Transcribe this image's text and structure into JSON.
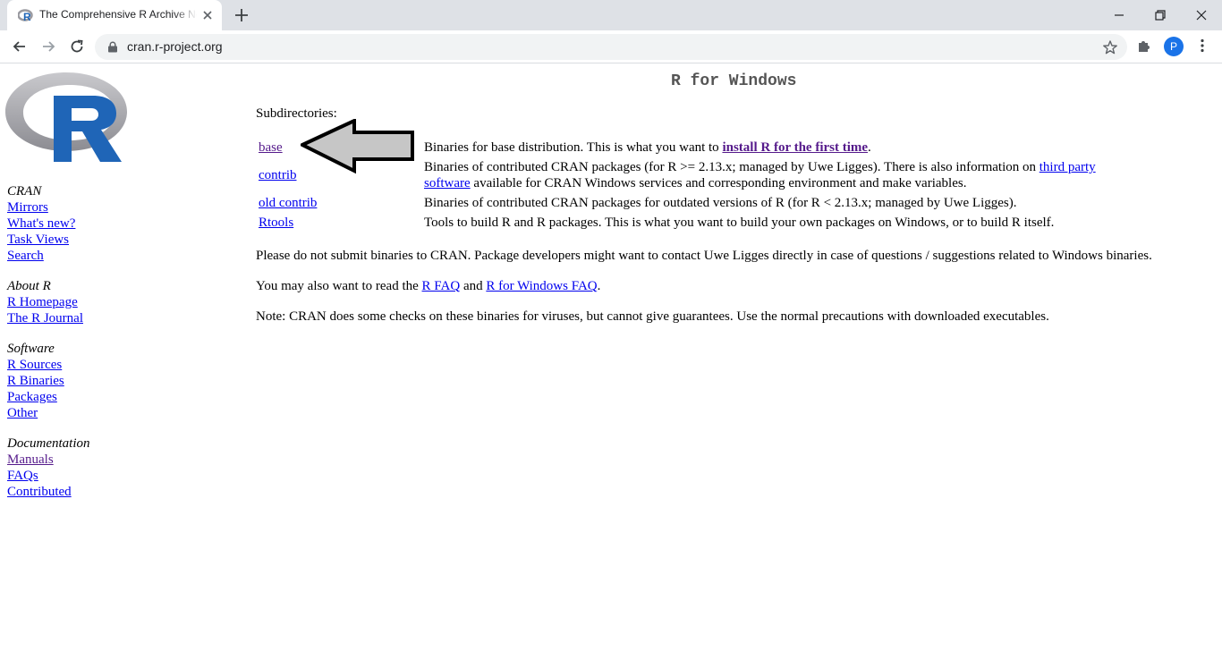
{
  "browser": {
    "tab_title": "The Comprehensive R Archive Network",
    "url": "cran.r-project.org",
    "avatar_letter": "P"
  },
  "sidebar": {
    "groups": [
      {
        "heading": "CRAN",
        "links": [
          "Mirrors",
          "What's new?",
          "Task Views",
          "Search"
        ]
      },
      {
        "heading": "About R",
        "links": [
          "R Homepage",
          "The R Journal"
        ]
      },
      {
        "heading": "Software",
        "links": [
          "R Sources",
          "R Binaries",
          "Packages",
          "Other"
        ]
      },
      {
        "heading": "Documentation",
        "links": [
          "Manuals",
          "FAQs",
          "Contributed"
        ]
      }
    ]
  },
  "main": {
    "title": "R for Windows",
    "subdir_label": "Subdirectories:",
    "rows": [
      {
        "name": "base",
        "desc_pre": "Binaries for base distribution. This is what you want to ",
        "desc_link": "install R for the first time",
        "desc_post": "."
      },
      {
        "name": "contrib",
        "desc_pre": "Binaries of contributed CRAN packages (for R >= 2.13.x; managed by Uwe Ligges). There is also information on ",
        "desc_link": "third party software",
        "desc_post": " available for CRAN Windows services and corresponding environment and make variables."
      },
      {
        "name": "old contrib",
        "desc": "Binaries of contributed CRAN packages for outdated versions of R (for R < 2.13.x; managed by Uwe Ligges)."
      },
      {
        "name": "Rtools",
        "desc": "Tools to build R and R packages. This is what you want to build your own packages on Windows, or to build R itself."
      }
    ],
    "para1": "Please do not submit binaries to CRAN. Package developers might want to contact Uwe Ligges directly in case of questions / suggestions related to Windows binaries.",
    "para2_pre": "You may also want to read the ",
    "para2_link1": "R FAQ",
    "para2_mid": " and ",
    "para2_link2": "R for Windows FAQ",
    "para2_post": ".",
    "para3": "Note: CRAN does some checks on these binaries for viruses, but cannot give guarantees. Use the normal precautions with downloaded executables."
  },
  "colors": {
    "link": "#0000ee",
    "visited": "#551a8b",
    "r_blue": "#1f65b7",
    "r_gray": "#a9a9ad"
  }
}
